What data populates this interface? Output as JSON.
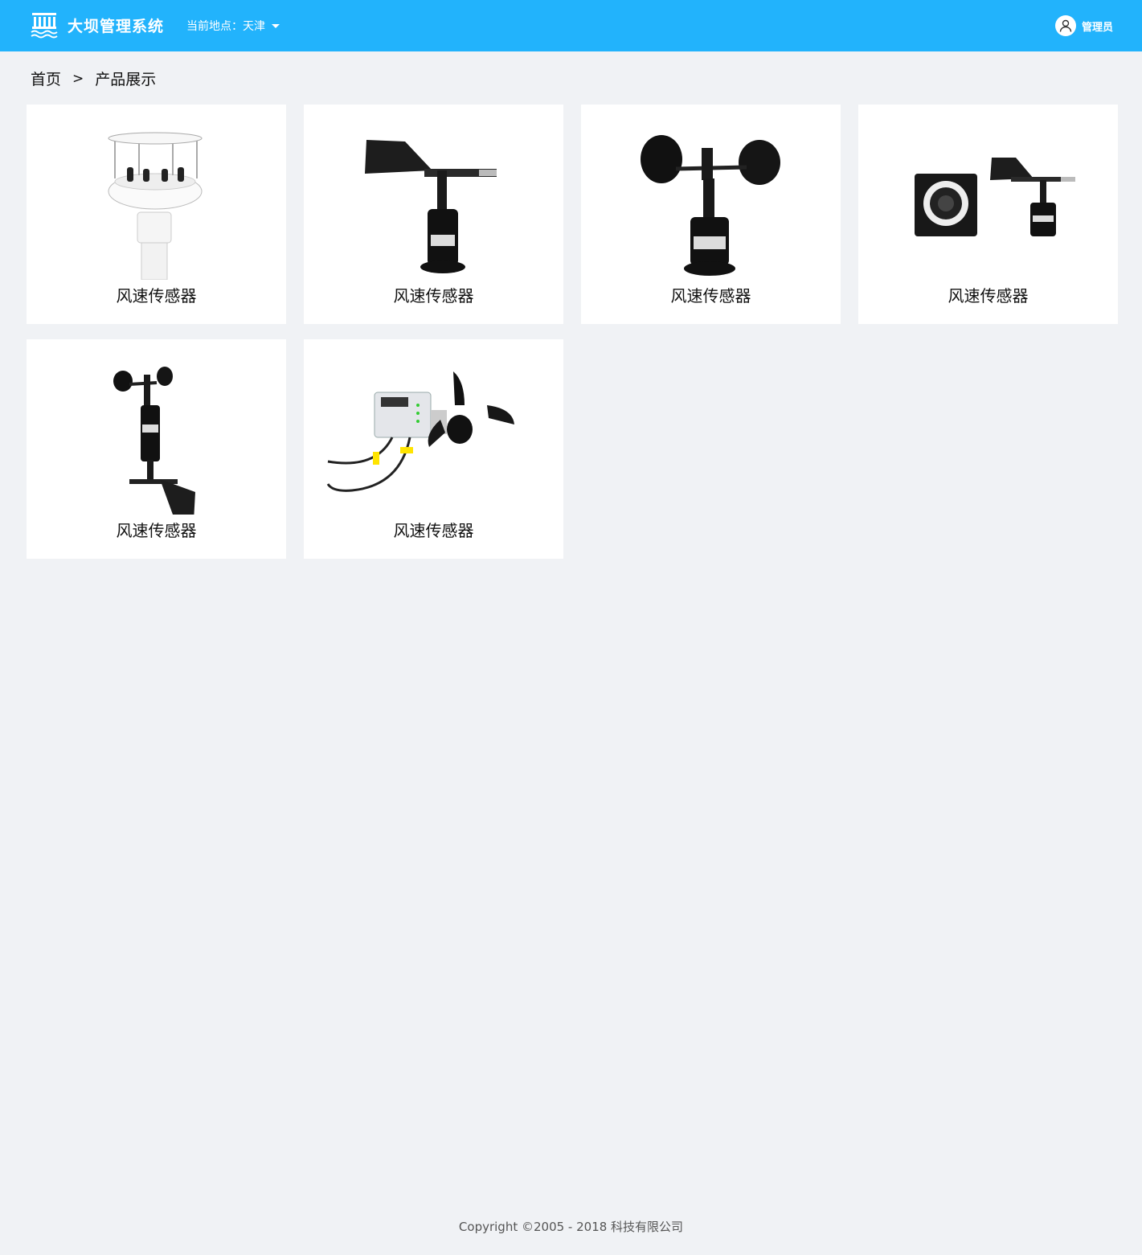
{
  "header": {
    "app_title": "大坝管理系统",
    "location_label": "当前地点：天津",
    "user_name": "管理员",
    "bg_color": "#22b3fc"
  },
  "breadcrumb": {
    "home": "首页",
    "separator": ">",
    "current": "产品展示"
  },
  "products": [
    {
      "name": "风速传感器",
      "icon": "ultrasonic-sensor-icon"
    },
    {
      "name": "风速传感器",
      "icon": "wind-vane-icon"
    },
    {
      "name": "风速传感器",
      "icon": "cup-anemometer-icon"
    },
    {
      "name": "风速传感器",
      "icon": "vane-with-display-icon"
    },
    {
      "name": "风速传感器",
      "icon": "anemometer-vane-combo-icon"
    },
    {
      "name": "风速传感器",
      "icon": "anemometer-with-controller-icon"
    }
  ],
  "footer": {
    "copyright": "Copyright ©2005 - 2018  科技有限公司"
  }
}
